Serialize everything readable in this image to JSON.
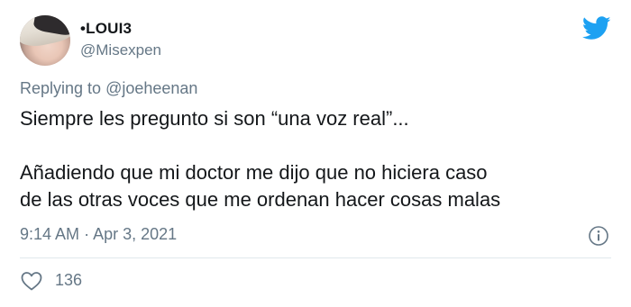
{
  "user": {
    "display_name": "•LOUI3",
    "handle": "@Misexpen",
    "avatar_icon": "profile-photo"
  },
  "brand": {
    "icon": "twitter-bird-icon",
    "color": "#1da1f2"
  },
  "reply": {
    "prefix": "Replying to",
    "mention": "@joeheenan"
  },
  "tweet": {
    "lines": [
      "Siempre les pregunto si son “una voz real”...",
      "Añadiendo que mi doctor me dijo que no hiciera caso",
      "de las otras voces que me ordenan hacer cosas malas"
    ]
  },
  "meta": {
    "time": "9:14 AM",
    "separator": "·",
    "date": "Apr 3, 2021"
  },
  "actions": {
    "likes_count": "136",
    "like_icon": "heart-icon",
    "info_icon": "info-icon"
  },
  "colors": {
    "text_primary": "#14171a",
    "text_secondary": "#657786",
    "divider": "#e1e8ed"
  }
}
